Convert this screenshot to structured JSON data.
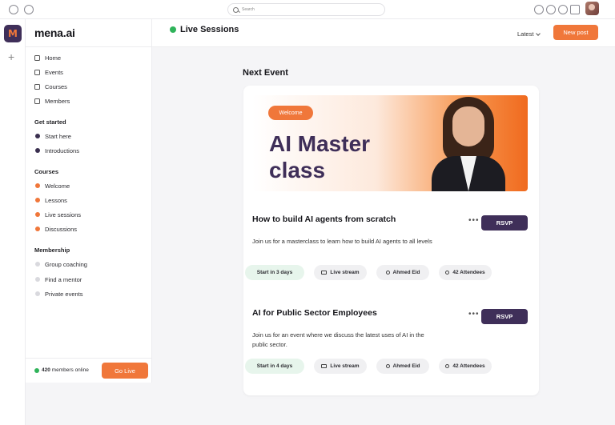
{
  "search": {
    "placeholder": "Search"
  },
  "sidebar": {
    "brand": "mena.ai",
    "nav": [
      {
        "label": "Home",
        "icon": "home-icon"
      },
      {
        "label": "Events",
        "icon": "calendar-icon"
      },
      {
        "label": "Courses",
        "icon": "book-icon"
      },
      {
        "label": "Members",
        "icon": "members-icon"
      }
    ],
    "sections": [
      {
        "title": "Get started",
        "items": [
          "Start here",
          "Introductions"
        ],
        "dot_color": "#3a2f4f"
      },
      {
        "title": "Courses",
        "items": [
          "Welcome",
          "Lessons",
          "Live sessions",
          "Discussions"
        ],
        "dot_color": "#f0773a"
      },
      {
        "title": "Membership",
        "items": [
          "Group coaching",
          "Find a mentor",
          "Private events"
        ],
        "dot_color": "#d9d9de"
      }
    ],
    "footer": {
      "count": "420",
      "online_label": "members online",
      "golive_label": "Go Live"
    }
  },
  "header": {
    "title": "Live Sessions",
    "sort_label": "Latest",
    "newpost_label": "New post"
  },
  "main": {
    "section_title": "Next Event",
    "banner": {
      "pill": "Welcome",
      "title": "AI Master class"
    },
    "events": [
      {
        "title": "How to build AI agents from scratch",
        "description": "Join us for a masterclass to learn how to build AI agents to all levels",
        "rsvp": "RSVP",
        "more": "•••",
        "chips": [
          "Start in 3 days",
          "Live stream",
          "Ahmed Eid",
          "42 Attendees"
        ]
      },
      {
        "title": "AI for Public Sector Employees",
        "description": "Join us for an event where we discuss the latest uses of AI in the public sector.",
        "rsvp": "RSVP",
        "more": "•••",
        "chips": [
          "Start in 4 days",
          "Live stream",
          "Ahmed Eid",
          "42 Attendees"
        ]
      }
    ]
  },
  "colors": {
    "accent": "#f0773a",
    "brand_dark": "#3f2f59",
    "online": "#2fb35a"
  }
}
